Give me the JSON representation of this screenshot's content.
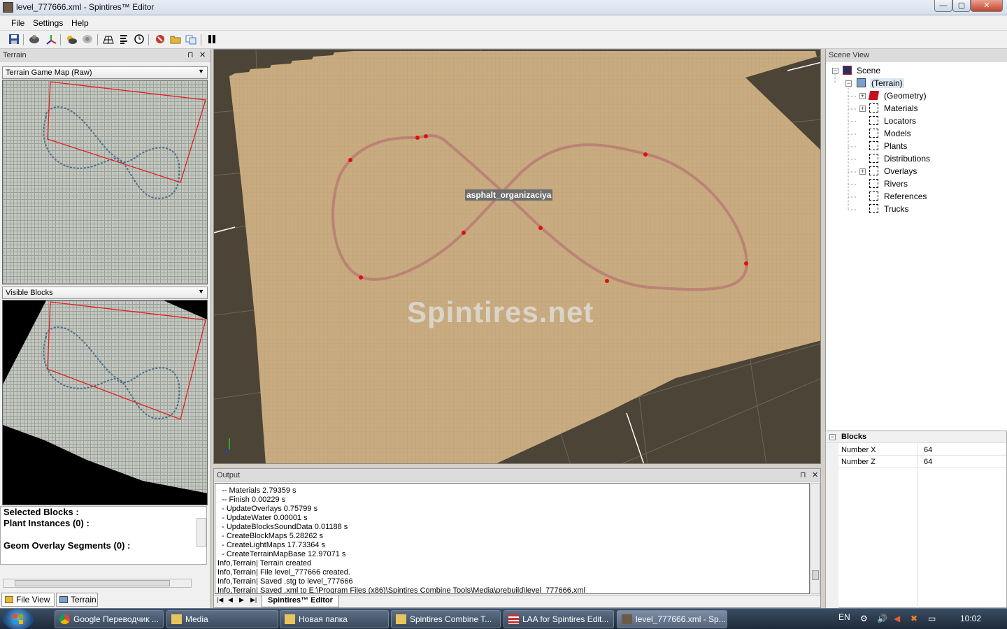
{
  "window": {
    "title": "level_777666.xml - Spintires™ Editor",
    "controls": {
      "minimize": "—",
      "maximize": "▢",
      "close": "✕"
    }
  },
  "menu": [
    "File",
    "Settings",
    "Help"
  ],
  "toolbar": {
    "icons": [
      "save-icon",
      "open-icon",
      "axes-icon",
      "weather-icon",
      "brush-icon",
      "grid-icon",
      "list-icon",
      "clock-icon",
      "delete-icon",
      "folder-icon",
      "copy-icon",
      "pause-icon"
    ]
  },
  "terrain_panel": {
    "title": "Terrain",
    "map_select": "Terrain Game Map (Raw)",
    "blocks_select": "Visible Blocks",
    "info": {
      "selected_blocks": "Selected Blocks :",
      "plant_instances": "Plant Instances (0) :",
      "geom_overlay": "Geom Overlay Segments (0) :"
    },
    "tabs": [
      "File View",
      "Terrain"
    ]
  },
  "viewport": {
    "track_label": "asphalt_organizaciya",
    "watermark": "Spintires.net"
  },
  "output": {
    "title": "Output",
    "lines": [
      "  -- Materials 2.79359 s",
      "  -- Finish 0.00229 s",
      "  - UpdateOverlays 0.75799 s",
      "  - UpdateWater 0.00001 s",
      "  - UpdateBlocksSoundData 0.01188 s",
      "  - CreateBlockMaps 5.28262 s",
      "  - CreateLightMaps 17.73364 s",
      "  - CreateTerrainMapBase 12.97071 s",
      "Info,Terrain| Terrain created",
      "Info,Terrain| File level_777666 created.",
      "Info,Terrain| Saved .stg to level_777666",
      "Info,Terrain| Saved .xml to E:\\Program Files (x86)\\Spintires Combine Tools\\Media\\prebuild\\level_777666.xml"
    ],
    "tab": "Spintires™ Editor",
    "nav": [
      "|◀",
      "◀",
      "▶",
      "▶|"
    ]
  },
  "scene_view": {
    "title": "Scene View",
    "root": "Scene",
    "terrain": "(Terrain)",
    "children": [
      "(Geometry)",
      "Materials",
      "Locators",
      "Models",
      "Plants",
      "Distributions",
      "Overlays",
      "Rivers",
      "References",
      "Trucks"
    ]
  },
  "properties": {
    "section": "Blocks",
    "rows": [
      {
        "name": "Number X",
        "value": "64"
      },
      {
        "name": "Number Z",
        "value": "64"
      }
    ]
  },
  "taskbar": {
    "tasks": [
      "Google Переводчик ...",
      "Media",
      "Новая папка",
      "Spintires Combine T...",
      "LAA for Spintires Edit...",
      "level_777666.xml - Sp..."
    ],
    "lang": "EN",
    "clock": "10:02"
  },
  "colors": {
    "sand": "#c8ab80",
    "ground": "#4b4437",
    "track": "#b87b74",
    "waypoint": "#e01010",
    "selection": "#e02020"
  }
}
